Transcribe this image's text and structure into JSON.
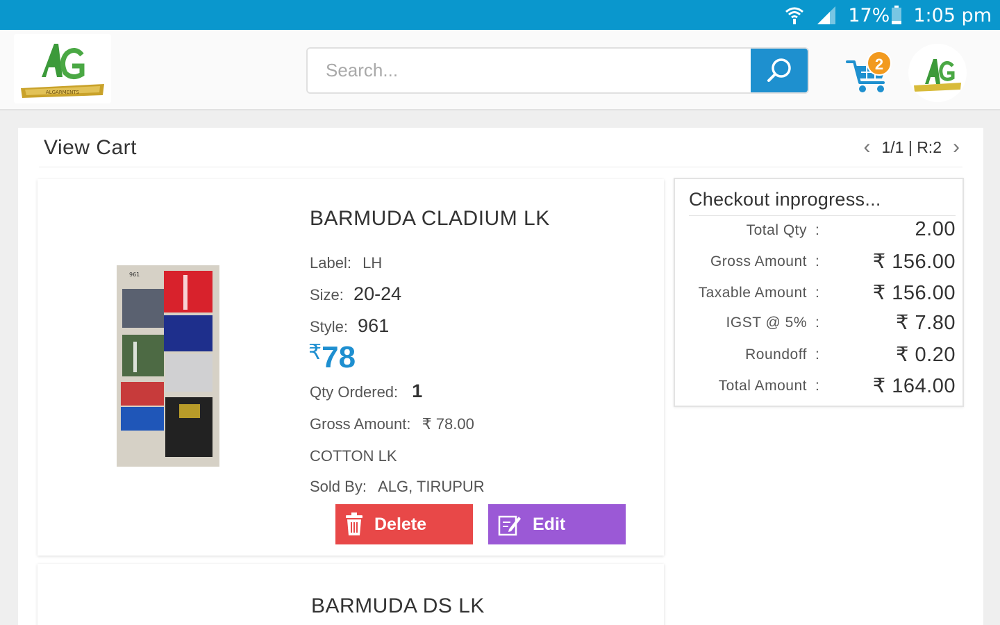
{
  "status_bar": {
    "battery": "17%",
    "time": "1:05 pm"
  },
  "header": {
    "logo_icon": "alg-logo",
    "search_placeholder": "Search...",
    "cart_count": "2",
    "colors": {
      "accent": "#1e90cf",
      "status_bar": "#0a97cd",
      "badge": "#f29a1f"
    }
  },
  "page": {
    "title": "View Cart",
    "pager": "1/1 | R:2"
  },
  "cart_items": [
    {
      "name": "BARMUDA CLADIUM LK",
      "label_caption": "Label:",
      "label_value": "LH",
      "size_caption": "Size:",
      "size_value": "20-24",
      "style_caption": "Style:",
      "style_value": "961",
      "price_currency": "₹",
      "price": "78",
      "qty_caption": "Qty Ordered:",
      "qty_value": "1",
      "gross_caption": "Gross Amount:",
      "gross_value": "₹ 78.00",
      "material": "COTTON LK",
      "sold_by_caption": "Sold By:",
      "sold_by_value": "ALG, TIRUPUR",
      "delete_label": "Delete",
      "edit_label": "Edit"
    },
    {
      "name": "BARMUDA DS LK"
    }
  ],
  "summary": {
    "title": "Checkout inprogress...",
    "rows": [
      {
        "label": "Total Qty",
        "value": "2.00"
      },
      {
        "label": "Gross Amount",
        "value": "₹ 156.00"
      },
      {
        "label": "Taxable Amount",
        "value": "₹ 156.00"
      },
      {
        "label": "IGST @ 5%",
        "value": "₹ 7.80"
      },
      {
        "label": "Roundoff",
        "value": "₹ 0.20"
      },
      {
        "label": "Total Amount",
        "value": "₹ 164.00"
      }
    ]
  }
}
